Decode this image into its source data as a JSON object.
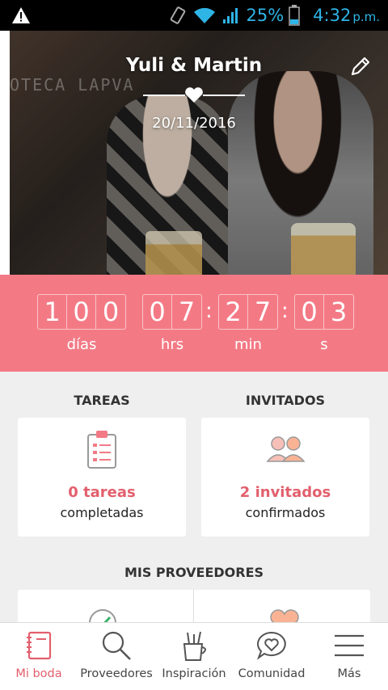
{
  "status_bar": {
    "battery_pct": "25%",
    "time": "4:32",
    "ampm": "p.m.",
    "icons": [
      "warning-icon",
      "vibrate-icon",
      "wifi-icon",
      "signal-icon",
      "battery-icon"
    ],
    "accent": "#2fb4e6"
  },
  "hero": {
    "names": "Yuli & Martin",
    "date": "20/11/2016",
    "bg_sign_text": "OTECA LAPVA"
  },
  "countdown": {
    "days": [
      "1",
      "0",
      "0"
    ],
    "hours": [
      "0",
      "7"
    ],
    "minutes": [
      "2",
      "7"
    ],
    "seconds": [
      "0",
      "3"
    ],
    "labels": {
      "days": "días",
      "hours": "hrs",
      "minutes": "min",
      "seconds": "s"
    },
    "color": "#f37a85"
  },
  "tasks": {
    "heading": "TAREAS",
    "count": "0 tareas",
    "sub": "completadas"
  },
  "guests": {
    "heading": "INVITADOS",
    "count": "2 invitados",
    "sub": "confirmados"
  },
  "providers": {
    "heading": "MIS PROVEEDORES"
  },
  "nav": {
    "items": [
      {
        "label": "Mi boda",
        "icon": "notebook-icon",
        "active": true
      },
      {
        "label": "Proveedores",
        "icon": "search-icon",
        "active": false
      },
      {
        "label": "Inspiración",
        "icon": "pencil-cup-icon",
        "active": false
      },
      {
        "label": "Comunidad",
        "icon": "chat-heart-icon",
        "active": false
      },
      {
        "label": "Más",
        "icon": "menu-icon",
        "active": false
      }
    ]
  },
  "colors": {
    "accent": "#e25f6d",
    "pink": "#f37a85"
  }
}
